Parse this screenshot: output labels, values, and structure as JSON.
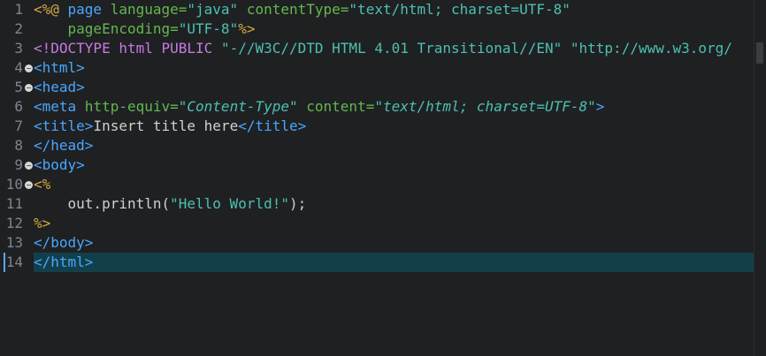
{
  "editor": {
    "lines": [
      {
        "n": "1",
        "segments": [
          {
            "t": "<%@ ",
            "c": "t-delim"
          },
          {
            "t": "page",
            "c": "t-kw"
          },
          {
            "t": " language=",
            "c": "t-attr"
          },
          {
            "t": "\"java\"",
            "c": "t-str"
          },
          {
            "t": " contentType=",
            "c": "t-attr"
          },
          {
            "t": "\"text/html; charset=UTF-8\"",
            "c": "t-str"
          }
        ]
      },
      {
        "n": "2",
        "segments": [
          {
            "t": "    pageEncoding=",
            "c": "t-attr"
          },
          {
            "t": "\"UTF-8\"",
            "c": "t-str"
          },
          {
            "t": "%>",
            "c": "t-delim"
          }
        ]
      },
      {
        "n": "3",
        "segments": [
          {
            "t": "<!DOCTYPE ",
            "c": "t-doctype"
          },
          {
            "t": "html ",
            "c": "t-doctype"
          },
          {
            "t": "PUBLIC ",
            "c": "t-doctype"
          },
          {
            "t": "\"-//W3C//DTD HTML 4.01 Transitional//EN\"",
            "c": "t-str"
          },
          {
            "t": " ",
            "c": "t-text"
          },
          {
            "t": "\"http://www.w3.org/",
            "c": "t-str"
          }
        ]
      },
      {
        "n": "4",
        "fold": true,
        "segments": [
          {
            "t": "<html>",
            "c": "t-tag"
          }
        ]
      },
      {
        "n": "5",
        "fold": true,
        "segments": [
          {
            "t": "<head>",
            "c": "t-tag"
          }
        ]
      },
      {
        "n": "6",
        "segments": [
          {
            "t": "<meta",
            "c": "t-tag"
          },
          {
            "t": " http-equiv=",
            "c": "t-attr"
          },
          {
            "t": "\"Content-Type\"",
            "c": "t-str-it"
          },
          {
            "t": " content=",
            "c": "t-attr"
          },
          {
            "t": "\"text/html; charset=UTF-8\"",
            "c": "t-str-it"
          },
          {
            "t": ">",
            "c": "t-tag"
          }
        ]
      },
      {
        "n": "7",
        "segments": [
          {
            "t": "<title>",
            "c": "t-tag"
          },
          {
            "t": "Insert title here",
            "c": "t-text"
          },
          {
            "t": "</title>",
            "c": "t-tag"
          }
        ]
      },
      {
        "n": "8",
        "segments": [
          {
            "t": "</head>",
            "c": "t-tag"
          }
        ]
      },
      {
        "n": "9",
        "fold": true,
        "segments": [
          {
            "t": "<body>",
            "c": "t-tag"
          }
        ]
      },
      {
        "n": "10",
        "fold": true,
        "segments": [
          {
            "t": "<%",
            "c": "t-delim"
          }
        ]
      },
      {
        "n": "11",
        "segments": [
          {
            "t": "    out.println(",
            "c": "t-java"
          },
          {
            "t": "\"Hello World!\"",
            "c": "t-str"
          },
          {
            "t": ");",
            "c": "t-java"
          }
        ]
      },
      {
        "n": "12",
        "segments": [
          {
            "t": "%>",
            "c": "t-delim"
          }
        ]
      },
      {
        "n": "13",
        "segments": [
          {
            "t": "</body>",
            "c": "t-tag"
          }
        ]
      },
      {
        "n": "14",
        "segments": [
          {
            "t": "</html>",
            "c": "t-tag"
          }
        ]
      }
    ],
    "current_line": "14"
  }
}
